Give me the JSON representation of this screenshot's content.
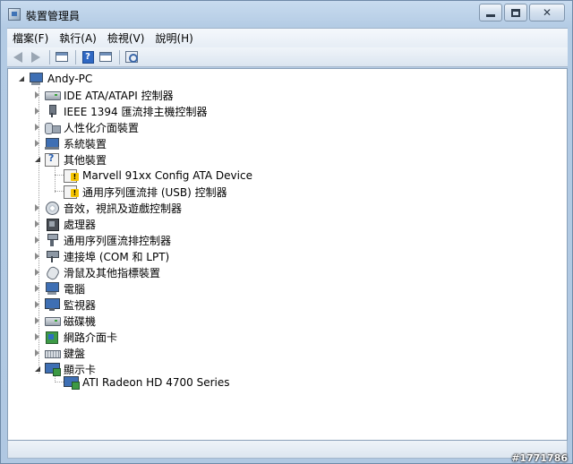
{
  "window": {
    "title": "裝置管理員"
  },
  "menu": [
    "檔案(F)",
    "執行(A)",
    "檢視(V)",
    "說明(H)"
  ],
  "tree": {
    "root": "Andy-PC",
    "items": [
      {
        "label": "IDE ATA/ATAPI 控制器",
        "icon": "disk-icon",
        "expanded": false
      },
      {
        "label": "IEEE 1394 匯流排主機控制器",
        "icon": "plug-icon",
        "expanded": false
      },
      {
        "label": "人性化介面裝置",
        "icon": "hid-icon",
        "expanded": false
      },
      {
        "label": "系統裝置",
        "icon": "system-icon",
        "expanded": false
      },
      {
        "label": "其他裝置",
        "icon": "other-devices-icon",
        "expanded": true,
        "children": [
          {
            "label": "Marvell 91xx Config ATA Device",
            "icon": "warning-device-icon"
          },
          {
            "label": "通用序列匯流排 (USB) 控制器",
            "icon": "warning-device-icon"
          }
        ]
      },
      {
        "label": "音效，視訊及遊戲控制器",
        "icon": "speaker-icon",
        "expanded": false
      },
      {
        "label": "處理器",
        "icon": "cpu-icon",
        "expanded": false
      },
      {
        "label": "通用序列匯流排控制器",
        "icon": "usb-icon",
        "expanded": false
      },
      {
        "label": "連接埠 (COM 和 LPT)",
        "icon": "port-icon",
        "expanded": false
      },
      {
        "label": "滑鼠及其他指標裝置",
        "icon": "mouse-icon",
        "expanded": false
      },
      {
        "label": "電腦",
        "icon": "computer-icon",
        "expanded": false
      },
      {
        "label": "監視器",
        "icon": "monitor-icon",
        "expanded": false
      },
      {
        "label": "磁碟機",
        "icon": "disk-drive-icon",
        "expanded": false
      },
      {
        "label": "網路介面卡",
        "icon": "network-adapter-icon",
        "expanded": false
      },
      {
        "label": "鍵盤",
        "icon": "keyboard-icon",
        "expanded": false
      },
      {
        "label": "顯示卡",
        "icon": "display-adapter-icon",
        "expanded": true,
        "children": [
          {
            "label": "ATI Radeon HD 4700 Series",
            "icon": "display-adapter-icon"
          }
        ]
      }
    ]
  },
  "watermark": "#1771786"
}
